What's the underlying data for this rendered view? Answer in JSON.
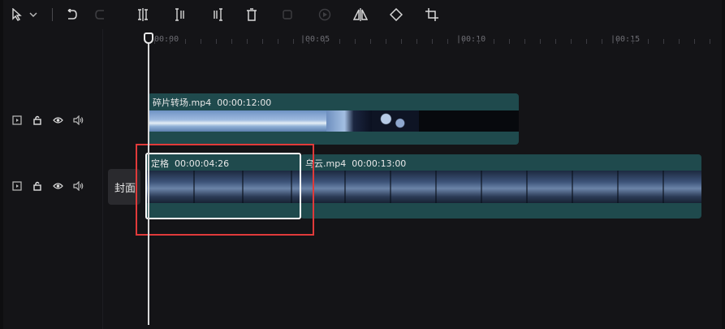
{
  "toolbar": {
    "items": [
      {
        "name": "select-tool-icon",
        "glyph": "⇱",
        "enabled": true
      },
      {
        "name": "dropdown-chevron-icon",
        "glyph": "⌄",
        "enabled": true
      },
      {
        "name": "undo-icon",
        "glyph": "↶",
        "enabled": true
      },
      {
        "name": "redo-icon",
        "glyph": "↷",
        "enabled": false
      },
      {
        "name": "split-icon",
        "glyph": "⌶",
        "enabled": true
      },
      {
        "name": "split-left-icon",
        "glyph": "⌶",
        "enabled": true
      },
      {
        "name": "split-right-icon",
        "glyph": "⌶",
        "enabled": true
      },
      {
        "name": "delete-icon",
        "glyph": "🗑",
        "enabled": true
      },
      {
        "name": "freeze-frame-icon",
        "glyph": "▢",
        "enabled": false
      },
      {
        "name": "reverse-icon",
        "glyph": "⊙",
        "enabled": false
      },
      {
        "name": "mirror-icon",
        "glyph": "⧗",
        "enabled": true
      },
      {
        "name": "rotate-icon",
        "glyph": "◇",
        "enabled": true
      },
      {
        "name": "crop-icon",
        "glyph": "⌗",
        "enabled": true
      }
    ]
  },
  "ruler": {
    "labels": [
      "00:00",
      "|00:05",
      "|00:10",
      "|00:15"
    ]
  },
  "tracks": [
    {
      "controls": [
        "preview-icon",
        "lock-icon",
        "visibility-icon",
        "audio-icon"
      ],
      "clips": [
        {
          "name": "碎片转场.mp4",
          "duration": "00:00:12:00"
        }
      ]
    },
    {
      "controls": [
        "preview-icon",
        "lock-icon",
        "visibility-icon",
        "audio-icon"
      ],
      "cover_label": "封面",
      "clips": [
        {
          "name": "定格",
          "duration": "00:00:04:26"
        },
        {
          "name": "乌云.mp4",
          "duration": "00:00:13:00"
        }
      ]
    }
  ],
  "colors": {
    "clip": "#1f4a4d",
    "selection": "#ffffff",
    "highlight": "#e03a3a",
    "playhead": "#d8d8d8"
  }
}
